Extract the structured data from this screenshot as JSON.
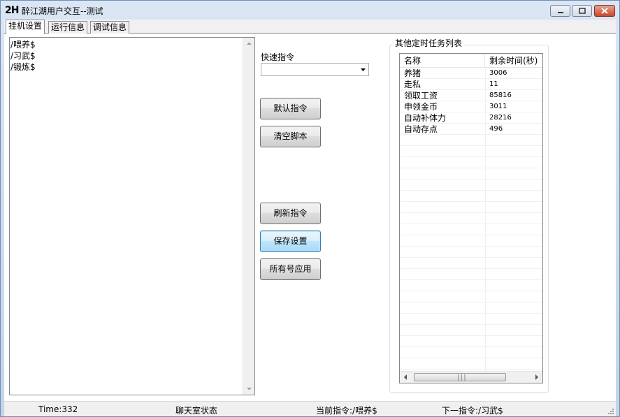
{
  "window": {
    "icon_text": "2H",
    "title": "醉江湖用户交互--测试"
  },
  "tabs": [
    {
      "label": "挂机设置",
      "active": true
    },
    {
      "label": "运行信息",
      "active": false
    },
    {
      "label": "调试信息",
      "active": false
    }
  ],
  "script": {
    "lines": [
      "/喂养$",
      "/习武$",
      "/锻炼$"
    ]
  },
  "quick_command": {
    "label": "快速指令",
    "value": ""
  },
  "buttons": {
    "default_cmd": "默认指令",
    "clear_script": "清空脚本",
    "refresh_cmd": "刷新指令",
    "save_settings": "保存设置",
    "apply_all": "所有号应用"
  },
  "task_list": {
    "group_title": "其他定时任务列表",
    "columns": [
      "名称",
      "剩余时间(秒)"
    ],
    "rows": [
      {
        "name": "养猪",
        "time": "3006"
      },
      {
        "name": "走私",
        "time": "11"
      },
      {
        "name": "领取工资",
        "time": "85816"
      },
      {
        "name": "申领金币",
        "time": "3011"
      },
      {
        "name": "自动补体力",
        "time": "28216"
      },
      {
        "name": "自动存点",
        "time": "496"
      }
    ]
  },
  "status": {
    "time": "Time:332",
    "chat": "聊天室状态",
    "current": "当前指令:/喂养$",
    "next": "下一指令:/习武$"
  },
  "icons": {
    "minimize": "minimize-icon",
    "maximize": "maximize-icon",
    "close": "close-icon",
    "dropdown": "chevron-down-icon",
    "scroll_up": "scroll-up-icon",
    "scroll_down": "scroll-down-icon",
    "scroll_left": "scroll-left-icon",
    "scroll_right": "scroll-right-icon"
  },
  "colors": {
    "close_button": "#c8462c",
    "focused_button": "#3c7fb1"
  }
}
